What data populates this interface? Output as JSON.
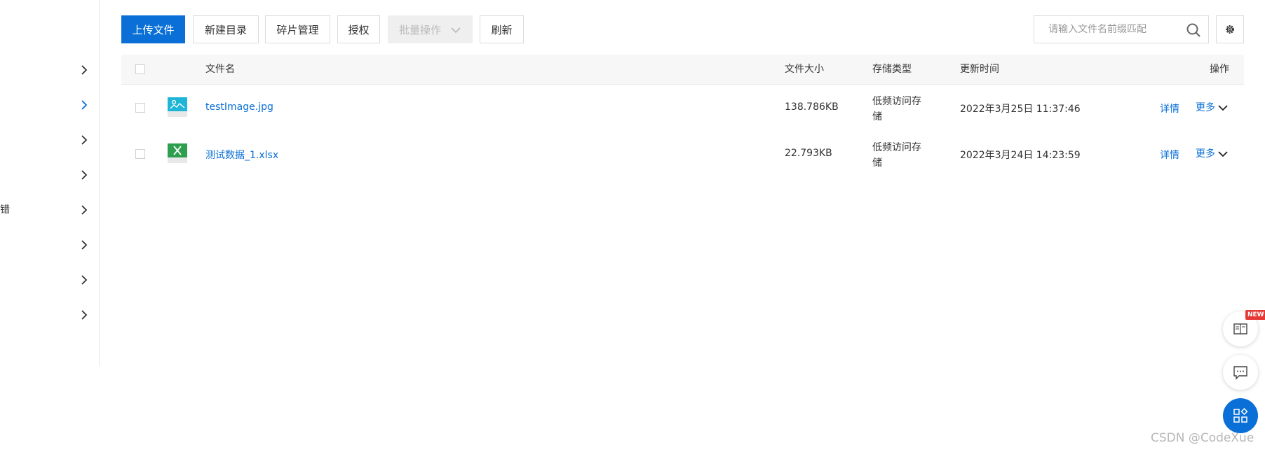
{
  "sidebar": {
    "items": [
      {
        "label": ""
      },
      {
        "label": "",
        "active": true
      },
      {
        "label": ""
      },
      {
        "label": ""
      },
      {
        "label": "错"
      },
      {
        "label": ""
      },
      {
        "label": ""
      },
      {
        "label": ""
      }
    ]
  },
  "toolbar": {
    "upload_label": "上传文件",
    "new_dir_label": "新建目录",
    "fragments_label": "碎片管理",
    "authorize_label": "授权",
    "batch_label": "批量操作",
    "refresh_label": "刷新"
  },
  "search": {
    "placeholder": "请输入文件名前缀匹配"
  },
  "table": {
    "headers": {
      "name": "文件名",
      "size": "文件大小",
      "storage": "存储类型",
      "updated": "更新时间",
      "actions": "操作"
    },
    "rows": [
      {
        "name": "testImage.jpg",
        "icon": "image-file-icon",
        "size": "138.786KB",
        "storage_line1": "低频访问存",
        "storage_line2": "储",
        "updated": "2022年3月25日 11:37:46",
        "details": "详情",
        "more": "更多"
      },
      {
        "name": "测试数据_1.xlsx",
        "icon": "excel-file-icon",
        "size": "22.793KB",
        "storage_line1": "低频访问存",
        "storage_line2": "储",
        "updated": "2022年3月24日 14:23:59",
        "details": "详情",
        "more": "更多"
      }
    ]
  },
  "float": {
    "new_badge": "NEW"
  },
  "watermark": "CSDN @CodeXue",
  "colors": {
    "primary": "#0a6fd6",
    "image_icon": "#1eb5d6",
    "excel_icon": "#2e9e4f",
    "badge": "#e53935"
  }
}
